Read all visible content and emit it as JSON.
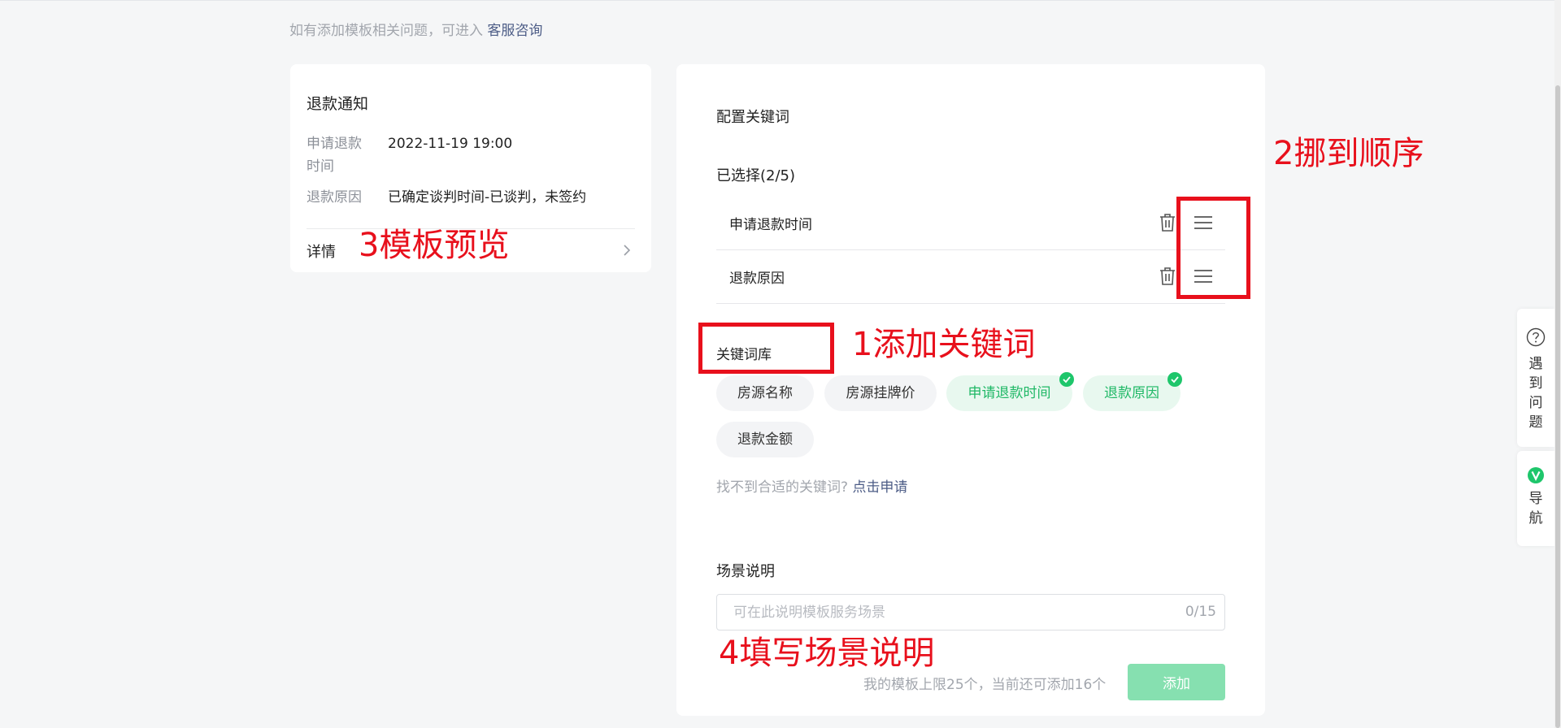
{
  "hint": {
    "text": "如有添加模板相关问题，可进入",
    "link": "客服咨询"
  },
  "preview": {
    "title": "退款通知",
    "rows": [
      {
        "key": "申请退款时间",
        "value": "2022-11-19 19:00"
      },
      {
        "key": "退款原因",
        "value": "已确定谈判时间-已谈判，未签约"
      }
    ],
    "detail_label": "详情"
  },
  "config": {
    "section_title": "配置关键词",
    "selected_label": "已选择(2/5)",
    "selected": [
      "申请退款时间",
      "退款原因"
    ],
    "library_title": "关键词库",
    "chips": [
      {
        "label": "房源名称",
        "selected": false
      },
      {
        "label": "房源挂牌价",
        "selected": false
      },
      {
        "label": "申请退款时间",
        "selected": true
      },
      {
        "label": "退款原因",
        "selected": true
      },
      {
        "label": "退款金额",
        "selected": false
      }
    ],
    "not_found_text": "找不到合适的关键词?",
    "not_found_link": "点击申请",
    "scene_title": "场景说明",
    "scene_placeholder": "可在此说明模板服务场景",
    "scene_count": "0/15",
    "limit_text": "我的模板上限25个，当前还可添加16个",
    "add_button": "添加"
  },
  "annotations": {
    "a1": "1添加关键词",
    "a2": "2挪到顺序",
    "a3": "3模板预览",
    "a4": "4填写场景说明"
  },
  "side_tools": {
    "help_label": "遇到问题",
    "nav_label": "导航"
  },
  "colors": {
    "accent_green": "#1ec66b",
    "annotation_red": "#e8101c",
    "link_blue": "#4c5c86",
    "add_button_disabled": "#86e0b0"
  }
}
